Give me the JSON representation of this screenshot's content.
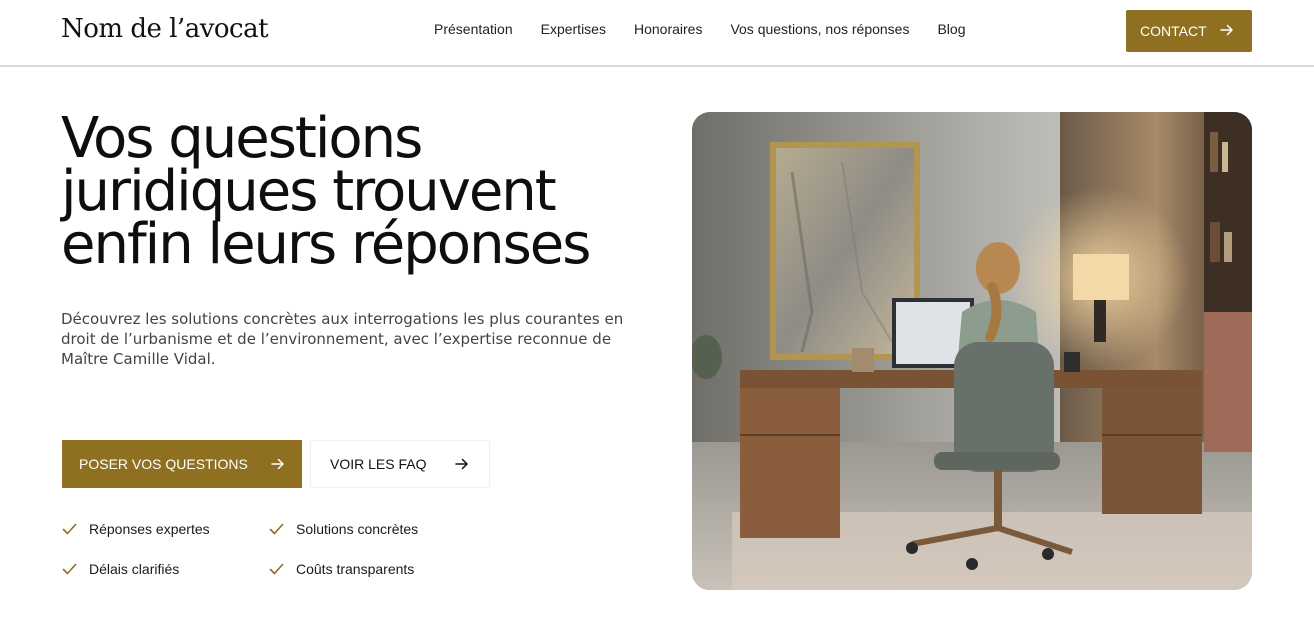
{
  "header": {
    "logo": "Nom de l’avocat",
    "nav": [
      "Présentation",
      "Expertises",
      "Honoraires",
      "Vos questions, nos réponses",
      "Blog"
    ],
    "contact_label": "CONTACT"
  },
  "hero": {
    "title": "Vos questions juridiques trouvent enfin leurs réponses",
    "subtitle": "Découvrez les solutions concrètes aux interrogations les plus courantes en droit de l’urbanisme et de l’environnement, avec l’expertise reconnue de Maître Camille Vidal.",
    "primary_button": "POSER VOS QUESTIONS",
    "secondary_button": "VOIR LES FAQ",
    "features": [
      "Réponses expertes",
      "Solutions concrètes",
      "Délais clarifiés",
      "Coûts transparents"
    ]
  },
  "colors": {
    "accent": "#8f7021",
    "check": "#8f7021"
  },
  "icons": {
    "arrow": "arrow-right-icon",
    "check": "check-icon"
  }
}
